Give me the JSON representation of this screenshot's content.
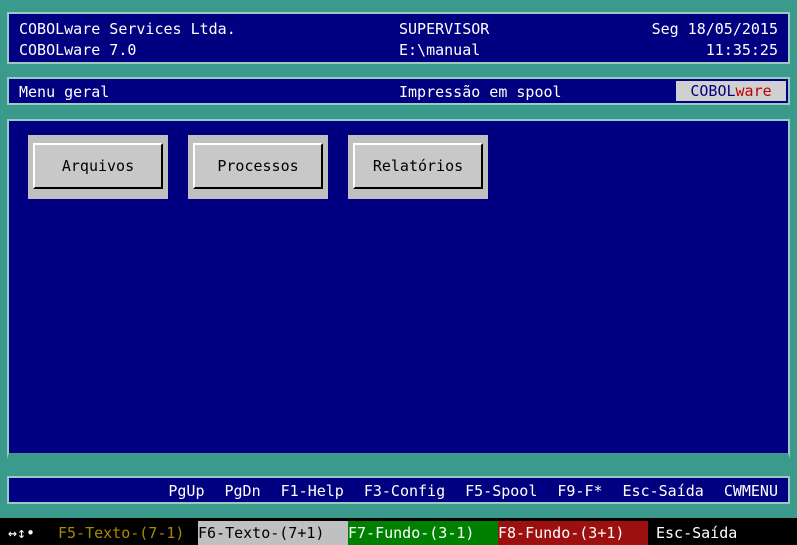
{
  "header": {
    "company": "COBOLware Services Ltda.",
    "product": "COBOLware 7.0",
    "user": "SUPERVISOR",
    "path": "E:\\manual",
    "date": "Seg 18/05/2015",
    "time": "11:35:25"
  },
  "menubar": {
    "title": "Menu geral",
    "status": "Impressão em spool",
    "brand_part1": "COBOL",
    "brand_part2": "ware"
  },
  "buttons": [
    {
      "label": "Arquivos"
    },
    {
      "label": "Processos"
    },
    {
      "label": "Relatórios"
    }
  ],
  "fkeys": [
    {
      "label": "PgUp"
    },
    {
      "label": "PgDn"
    },
    {
      "label": "F1-Help"
    },
    {
      "label": "F3-Config"
    },
    {
      "label": "F5-Spool"
    },
    {
      "label": "F9-F*"
    },
    {
      "label": "Esc-Saída"
    },
    {
      "label": "CWMENU"
    }
  ],
  "statusline": {
    "arrows": "↔↕•",
    "f5": "F5-Texto-(7-1)",
    "f6": "F6-Texto-(7+1)",
    "f7": "F7-Fundo-(3-1)",
    "f8": "F8-Fundo-(3+1)",
    "esc": "Esc-Saída"
  },
  "colors": {
    "screen_bg": "#000080",
    "frame": "#3a9a8c",
    "button": "#c8c8c8"
  }
}
